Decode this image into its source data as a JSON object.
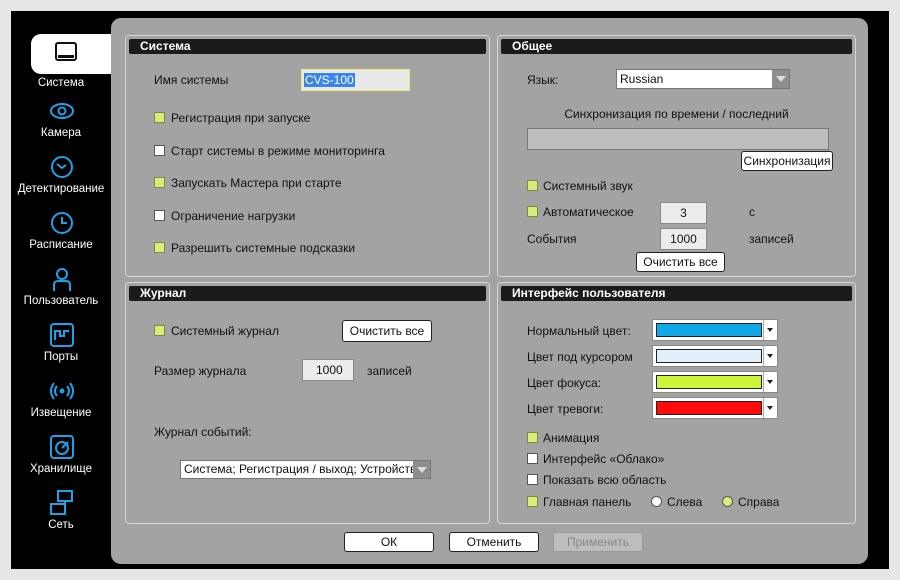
{
  "sidebar": {
    "items": [
      {
        "label": "Система",
        "icon": "monitor-icon"
      },
      {
        "label": "Камера",
        "icon": "eye-icon"
      },
      {
        "label": "Детектирование",
        "icon": "detection-icon"
      },
      {
        "label": "Расписание",
        "icon": "clock-icon"
      },
      {
        "label": "Пользователь",
        "icon": "user-icon"
      },
      {
        "label": "Порты",
        "icon": "ports-icon"
      },
      {
        "label": "Извещение",
        "icon": "broadcast-icon"
      },
      {
        "label": "Хранилище",
        "icon": "storage-icon"
      },
      {
        "label": "Сеть",
        "icon": "network-icon"
      }
    ]
  },
  "system": {
    "title": "Система",
    "name_label": "Имя системы",
    "name_value": "CVS-100",
    "checks": [
      {
        "label": "Регистрация при запуске",
        "checked": true
      },
      {
        "label": "Старт системы в режиме мониторинга",
        "checked": false
      },
      {
        "label": "Запускать Мастера при старте",
        "checked": true
      },
      {
        "label": "Ограничение нагрузки",
        "checked": false
      },
      {
        "label": "Разрешить системные подсказки",
        "checked": true
      }
    ]
  },
  "general": {
    "title": "Общее",
    "lang_label": "Язык:",
    "lang_value": "Russian",
    "sync_label": "Синхронизация по времени / последний",
    "sync_button": "Синхронизация",
    "sound_label": "Системный звук",
    "auto_label": "Автоматическое",
    "auto_value": "3",
    "auto_unit": "с",
    "events_label": "События",
    "events_value": "1000",
    "events_unit": "записей",
    "clear_button": "Очистить все"
  },
  "journal": {
    "title": "Журнал",
    "sys_journal_label": "Системный журнал",
    "clear_button": "Очистить все",
    "size_label": "Размер журнала",
    "size_value": "1000",
    "size_unit": "записей",
    "events_label": "Журнал событий:",
    "events_value": "Система; Регистрация / выход; Устройств..."
  },
  "ui": {
    "title": "Интерфейс пользователя",
    "colors": [
      {
        "label": "Нормальный цвет:",
        "color": "#12a9e8"
      },
      {
        "label": "Цвет под курсором",
        "color": "#e3f0fb"
      },
      {
        "label": "Цвет фокуса:",
        "color": "#ccf53a"
      },
      {
        "label": "Цвет тревоги:",
        "color": "#ff0a0a"
      }
    ],
    "checks": [
      {
        "label": "Анимация",
        "checked": true
      },
      {
        "label": "Интерфейс «Облако»",
        "checked": false
      },
      {
        "label": "Показать всю область",
        "checked": false
      },
      {
        "label": "Главная панель",
        "checked": true
      }
    ],
    "radio_left": "Слева",
    "radio_right": "Справа"
  },
  "footer": {
    "ok": "ОК",
    "cancel": "Отменить",
    "apply": "Применить"
  }
}
